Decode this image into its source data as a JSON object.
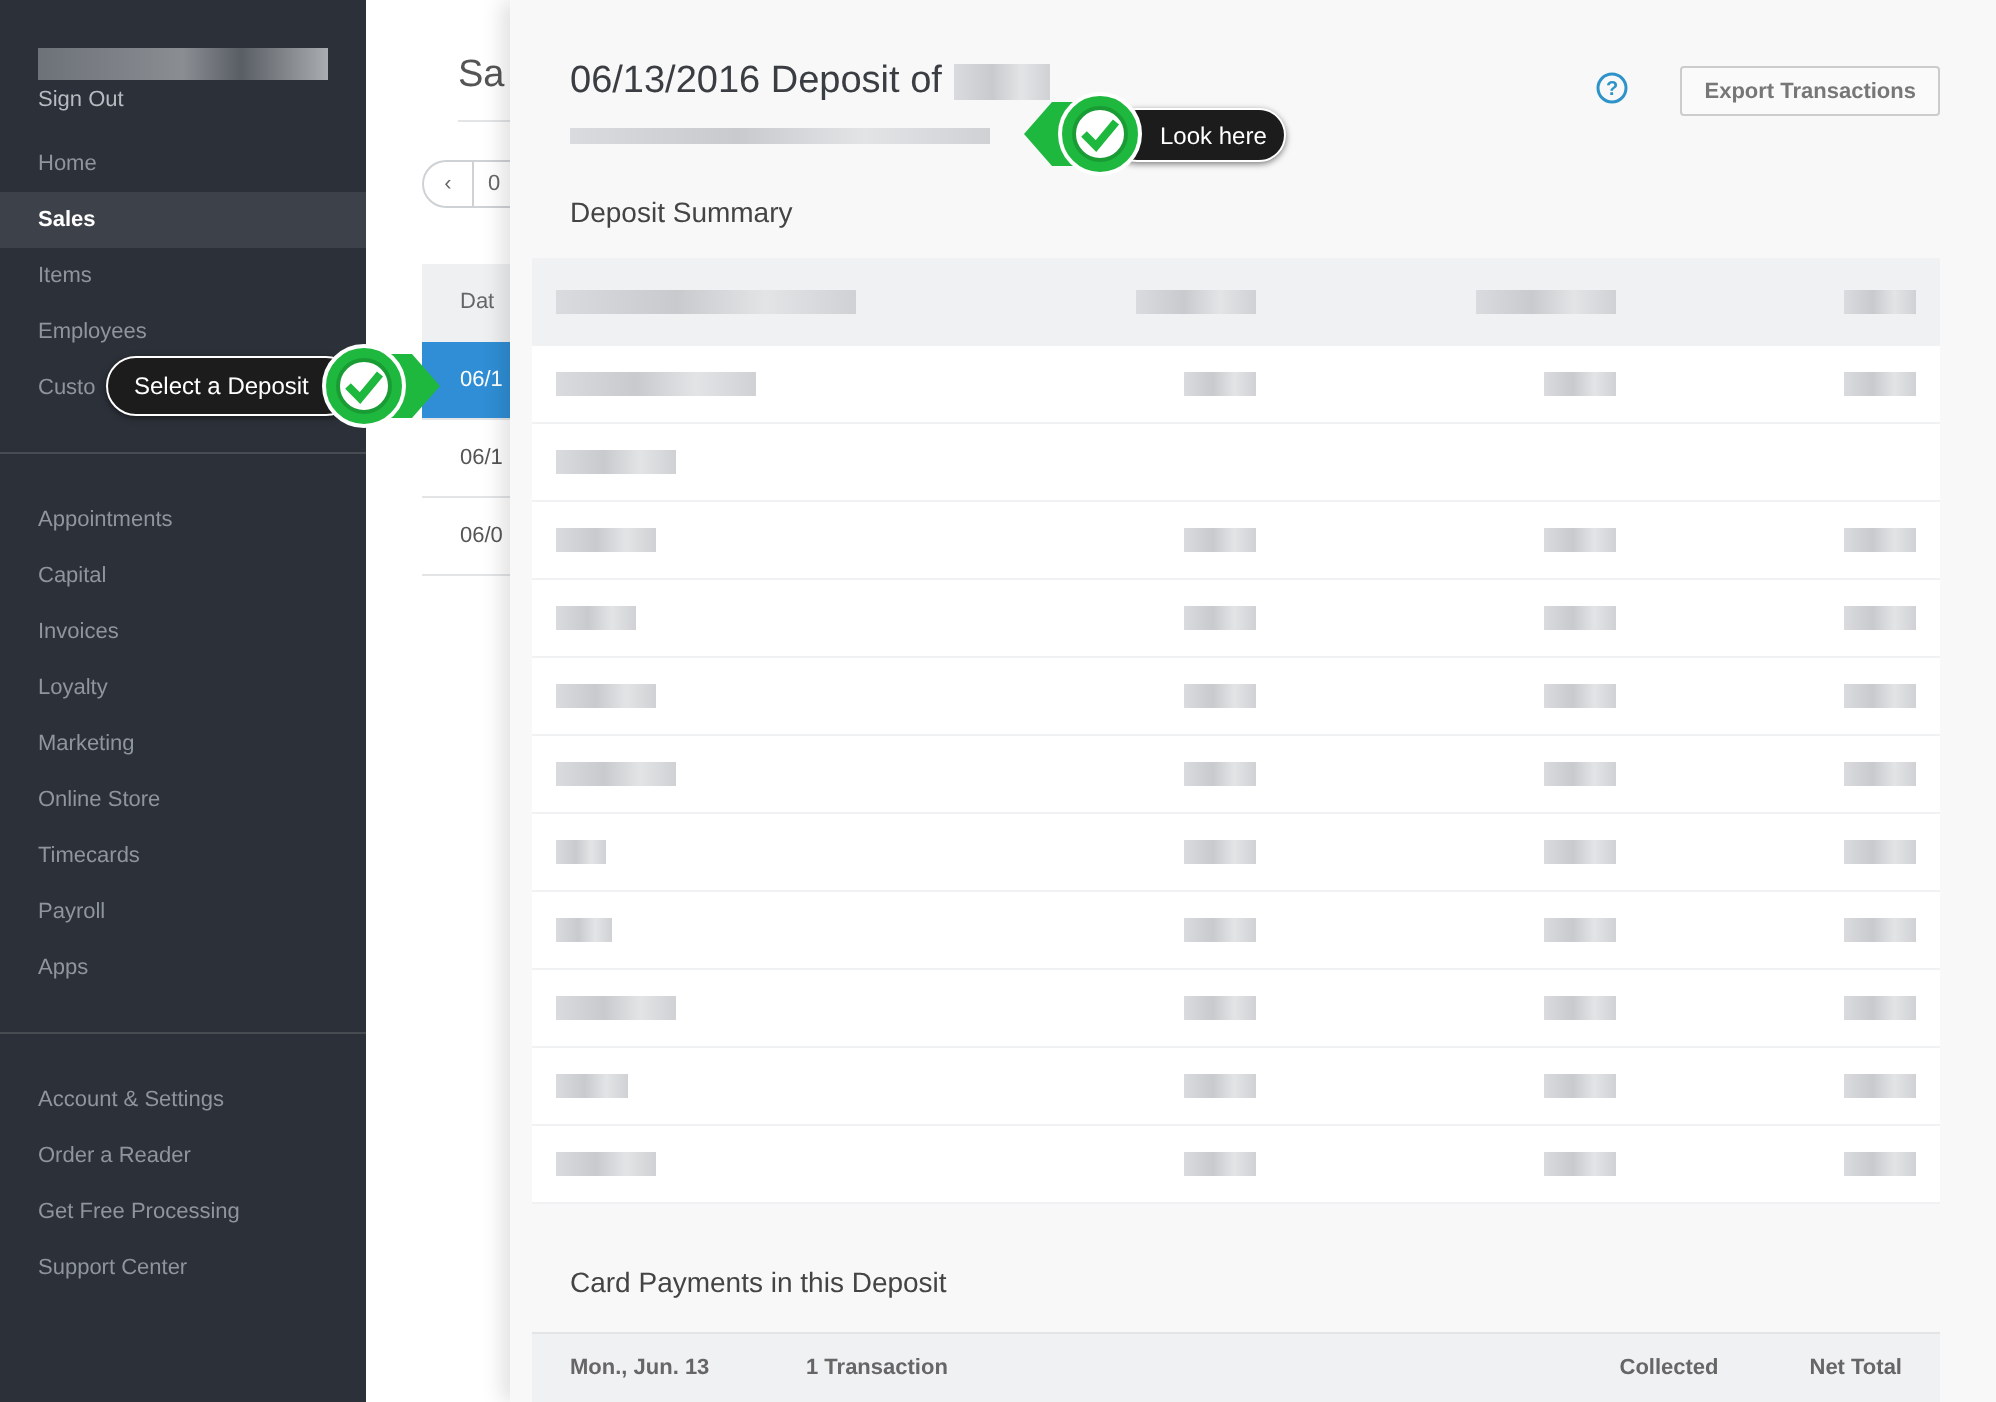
{
  "sidebar": {
    "sign_out": "Sign Out",
    "groups": [
      {
        "items": [
          {
            "label": "Home",
            "selected": false
          },
          {
            "label": "Sales",
            "selected": true
          },
          {
            "label": "Items",
            "selected": false
          },
          {
            "label": "Employees",
            "selected": false
          },
          {
            "label": "Custo",
            "selected": false
          }
        ]
      },
      {
        "items": [
          {
            "label": "Appointments",
            "selected": false
          },
          {
            "label": "Capital",
            "selected": false
          },
          {
            "label": "Invoices",
            "selected": false
          },
          {
            "label": "Loyalty",
            "selected": false
          },
          {
            "label": "Marketing",
            "selected": false
          },
          {
            "label": "Online Store",
            "selected": false
          },
          {
            "label": "Timecards",
            "selected": false
          },
          {
            "label": "Payroll",
            "selected": false
          },
          {
            "label": "Apps",
            "selected": false
          }
        ]
      },
      {
        "items": [
          {
            "label": "Account & Settings",
            "selected": false
          },
          {
            "label": "Order a Reader",
            "selected": false
          },
          {
            "label": "Get Free Processing",
            "selected": false
          },
          {
            "label": "Support Center",
            "selected": false
          }
        ]
      }
    ]
  },
  "sales": {
    "title": "Sa",
    "pager_prev": "‹",
    "pager_value": "0",
    "table": {
      "header": "Dat",
      "rows": [
        {
          "date": "06/1",
          "selected": true
        },
        {
          "date": "06/1",
          "selected": false
        },
        {
          "date": "06/0",
          "selected": false
        }
      ]
    }
  },
  "deposit": {
    "title": "06/13/2016 Deposit of",
    "help": "?",
    "export_button": "Export Transactions",
    "summary_title": "Deposit Summary",
    "card_payments": {
      "title": "Card Payments in this Deposit",
      "columns": [
        "Mon., Jun. 13",
        "1 Transaction",
        "Collected",
        "Net Total"
      ]
    }
  },
  "callouts": [
    {
      "label": "Select a Deposit",
      "kind": "rightward"
    },
    {
      "label": "Look here",
      "kind": "leftward"
    }
  ]
}
